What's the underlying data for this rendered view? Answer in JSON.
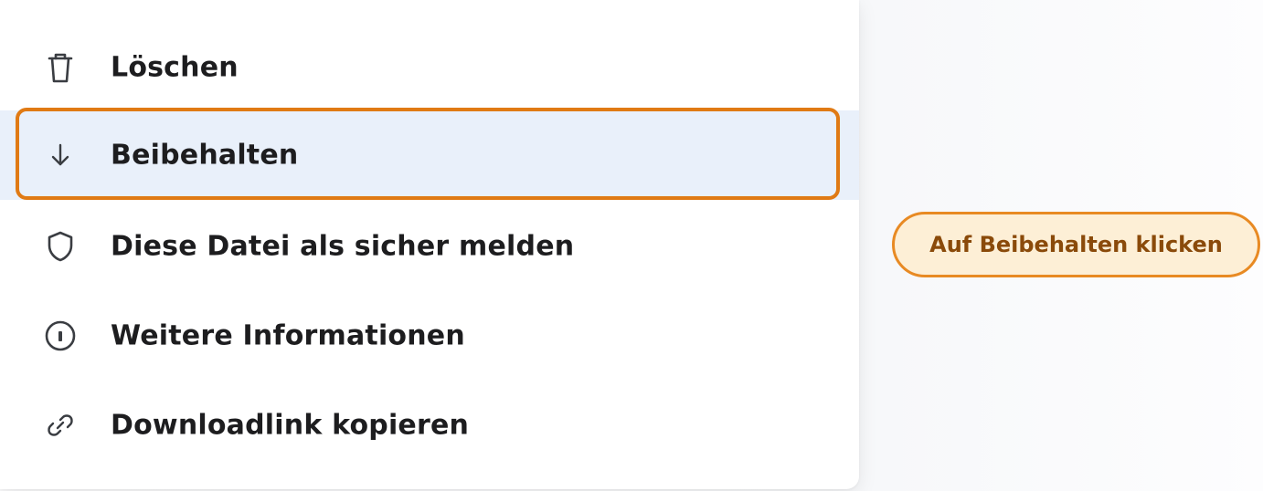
{
  "menu": {
    "items": [
      {
        "label": "Löschen",
        "icon": "trash-icon"
      },
      {
        "label": "Beibehalten",
        "icon": "arrow-down-icon",
        "highlighted": true
      },
      {
        "label": "Diese Datei als sicher melden",
        "icon": "shield-icon"
      },
      {
        "label": "Weitere Informationen",
        "icon": "info-icon"
      },
      {
        "label": "Downloadlink kopieren",
        "icon": "link-icon"
      }
    ]
  },
  "hint": {
    "text": "Auf Beibehalten klicken"
  },
  "colors": {
    "highlight_bg": "#e9f0fa",
    "focus_ring": "#e07a14",
    "hint_bg": "#fdefd6",
    "hint_border": "#e88a23",
    "hint_text": "#8a4a0a",
    "label_text": "#1d1d1f",
    "icon_stroke": "#3a3d42"
  }
}
